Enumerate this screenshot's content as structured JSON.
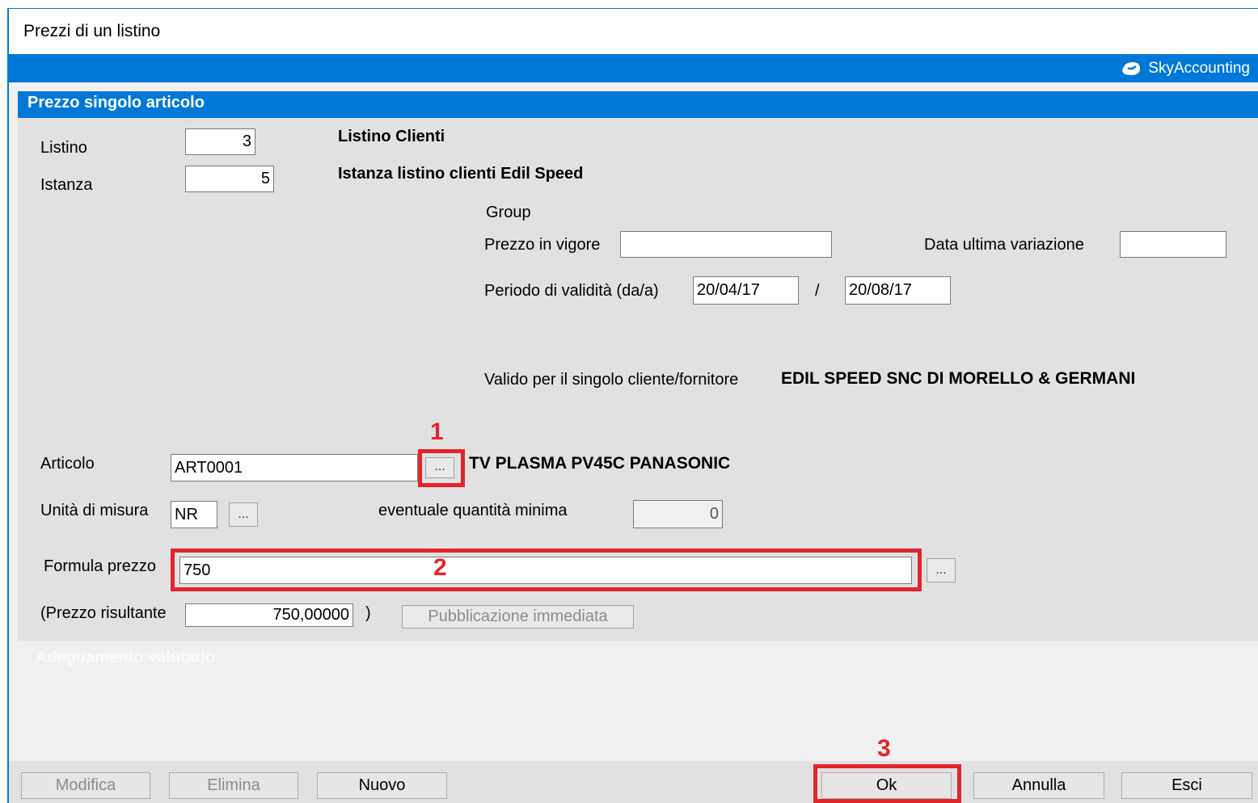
{
  "window": {
    "title": "Prezzi di un listino",
    "brand": "SkyAccounting"
  },
  "panel": {
    "title": "Prezzo singolo articolo",
    "section2_title": "Adeguamento valutario"
  },
  "listino": {
    "label": "Listino",
    "value": "3",
    "description": "Listino Clienti"
  },
  "istanza": {
    "label": "Istanza",
    "value": "5",
    "description": "Istanza listino clienti Edil Speed"
  },
  "group": {
    "label": "Group",
    "prezzo_in_vigore_label": "Prezzo in vigore",
    "prezzo_in_vigore_value": "",
    "data_ultima_variazione_label": "Data ultima variazione",
    "data_ultima_variazione_value": "",
    "periodo_label": "Periodo di validità (da/a)",
    "periodo_da": "20/04/17",
    "periodo_separator": "/",
    "periodo_a": "20/08/17"
  },
  "valido": {
    "label": "Valido per il singolo cliente/fornitore",
    "value": "EDIL SPEED SNC DI MORELLO & GERMANI"
  },
  "articolo": {
    "label": "Articolo",
    "value": "ART0001",
    "button_label": "...",
    "description": "TV PLASMA PV45C PANASONIC"
  },
  "unita": {
    "label": "Unità di misura",
    "value": "NR",
    "button_label": "...",
    "qta_min_label": "eventuale quantità minima",
    "qta_min_value": "0"
  },
  "formula": {
    "label": "Formula prezzo",
    "value": "750",
    "button_label": "..."
  },
  "risultante": {
    "label": "(Prezzo risultante",
    "value": "750,00000",
    "close": ")",
    "pubblicazione_label": "Pubblicazione immediata"
  },
  "annotations": {
    "n1": "1",
    "n2": "2",
    "n3": "3"
  },
  "buttons": {
    "modifica": "Modifica",
    "elimina": "Elimina",
    "nuovo": "Nuovo",
    "ok": "Ok",
    "annulla": "Annulla",
    "esci": "Esci"
  },
  "colors": {
    "accent": "#0078d7",
    "annotation": "#e3242b",
    "panel": "#e1e1e1"
  }
}
